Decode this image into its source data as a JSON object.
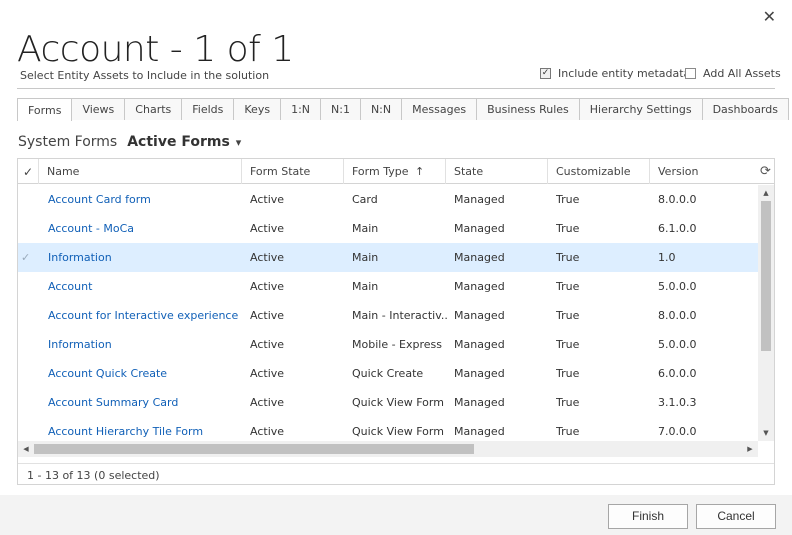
{
  "dialog": {
    "title": "Account - 1 of 1",
    "subtitle": "Select Entity Assets to Include in the solution",
    "close_glyph": "✕"
  },
  "options": {
    "include_metadata": {
      "label": "Include entity metadata",
      "checked": true
    },
    "add_all_assets": {
      "label": "Add All Assets",
      "checked": false
    }
  },
  "tabs": [
    {
      "label": "Forms",
      "active": true
    },
    {
      "label": "Views"
    },
    {
      "label": "Charts"
    },
    {
      "label": "Fields"
    },
    {
      "label": "Keys"
    },
    {
      "label": "1:N"
    },
    {
      "label": "N:1"
    },
    {
      "label": "N:N"
    },
    {
      "label": "Messages"
    },
    {
      "label": "Business Rules"
    },
    {
      "label": "Hierarchy Settings"
    },
    {
      "label": "Dashboards"
    }
  ],
  "view": {
    "label": "System Forms",
    "selected": "Active Forms",
    "chevron": "⌄"
  },
  "grid": {
    "columns": [
      "Name",
      "Form State",
      "Form Type",
      "State",
      "Customizable",
      "Version"
    ],
    "sort_indicator": "↑",
    "rows": [
      {
        "name": "Account Card form",
        "form_state": "Active",
        "form_type": "Card",
        "state": "Managed",
        "customizable": "True",
        "version": "8.0.0.0"
      },
      {
        "name": "Account - MoCa",
        "form_state": "Active",
        "form_type": "Main",
        "state": "Managed",
        "customizable": "True",
        "version": "6.1.0.0"
      },
      {
        "name": "Information",
        "form_state": "Active",
        "form_type": "Main",
        "state": "Managed",
        "customizable": "True",
        "version": "1.0",
        "selected": true
      },
      {
        "name": "Account",
        "form_state": "Active",
        "form_type": "Main",
        "state": "Managed",
        "customizable": "True",
        "version": "5.0.0.0"
      },
      {
        "name": "Account for Interactive experience",
        "form_state": "Active",
        "form_type": "Main - Interactiv...",
        "state": "Managed",
        "customizable": "True",
        "version": "8.0.0.0"
      },
      {
        "name": "Information",
        "form_state": "Active",
        "form_type": "Mobile - Express",
        "state": "Managed",
        "customizable": "True",
        "version": "5.0.0.0"
      },
      {
        "name": "Account Quick Create",
        "form_state": "Active",
        "form_type": "Quick Create",
        "state": "Managed",
        "customizable": "True",
        "version": "6.0.0.0"
      },
      {
        "name": "Account Summary Card",
        "form_state": "Active",
        "form_type": "Quick View Form",
        "state": "Managed",
        "customizable": "True",
        "version": "3.1.0.3"
      },
      {
        "name": "Account Hierarchy Tile Form",
        "form_state": "Active",
        "form_type": "Quick View Form",
        "state": "Managed",
        "customizable": "True",
        "version": "7.0.0.0"
      }
    ],
    "footer": "1 - 13 of 13 (0 selected)"
  },
  "buttons": {
    "finish": "Finish",
    "cancel": "Cancel"
  }
}
